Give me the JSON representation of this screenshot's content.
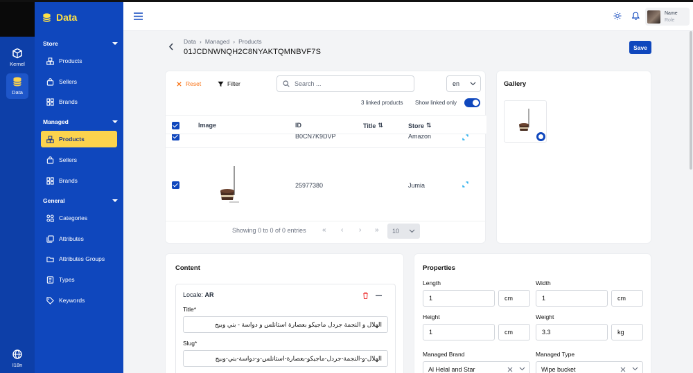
{
  "rail": {
    "items": [
      {
        "label": "Kernel",
        "icon": "cube-icon"
      },
      {
        "label": "Data",
        "icon": "database-icon"
      },
      {
        "label": "I18n",
        "icon": "globe-icon"
      }
    ]
  },
  "sidebar": {
    "brand": "Data",
    "sections": [
      {
        "title": "Store",
        "items": [
          "Products",
          "Sellers",
          "Brands"
        ]
      },
      {
        "title": "Managed",
        "items": [
          "Products",
          "Sellers",
          "Brands"
        ]
      },
      {
        "title": "General",
        "items": [
          "Categories",
          "Attributes",
          "Attributes Groups",
          "Types",
          "Keywords"
        ]
      }
    ]
  },
  "header": {
    "user_name": "Name",
    "user_role": "Role"
  },
  "page": {
    "breadcrumb": [
      "Data",
      "Managed",
      "Products"
    ],
    "product_id": "01JCDNWNQH2C8NYAKTQMNBVF7S",
    "save_label": "Save"
  },
  "products_card": {
    "reset_label": "Reset",
    "filter_label": "Filter",
    "search_placeholder": "Search ...",
    "language": "en",
    "linked_count": "3 linked products",
    "show_linked_label": "Show linked only",
    "columns": [
      "Image",
      "ID",
      "Title",
      "Store"
    ],
    "rows": [
      {
        "id": "B0CN7K9DVP",
        "store": "Amazon"
      },
      {
        "id": "25977380",
        "store": "Jumia"
      }
    ],
    "pager_text": "Showing 0 to 0 of 0 entries",
    "per_page": "10"
  },
  "gallery": {
    "title": "Gallery"
  },
  "content_card": {
    "title": "Content",
    "locale_label": "Locale:",
    "locale_value": "AR",
    "title_label": "Title*",
    "title_value": "الهلال و النجمة جردل ماجيكو بعصارة استانلس و دواسة - بني وبيج",
    "slug_label": "Slug*",
    "slug_value": "الهلال-و-النجمة-جردل-ماجيكو-بعصارة-استانلس-و-دواسة-بني-وبيج"
  },
  "properties": {
    "title": "Properties",
    "length_label": "Length",
    "length_value": "1",
    "length_unit": "cm",
    "width_label": "Width",
    "width_value": "1",
    "width_unit": "cm",
    "height_label": "Height",
    "height_value": "1",
    "height_unit": "cm",
    "weight_label": "Weight",
    "weight_value": "3.3",
    "weight_unit": "kg",
    "brand_label": "Managed Brand",
    "brand_value": "Al Helal and Star",
    "type_label": "Managed Type",
    "type_value": "Wipe bucket"
  },
  "colors": {
    "primary": "#0f47bd",
    "accent": "#fcd34d",
    "reset": "#f97316"
  }
}
